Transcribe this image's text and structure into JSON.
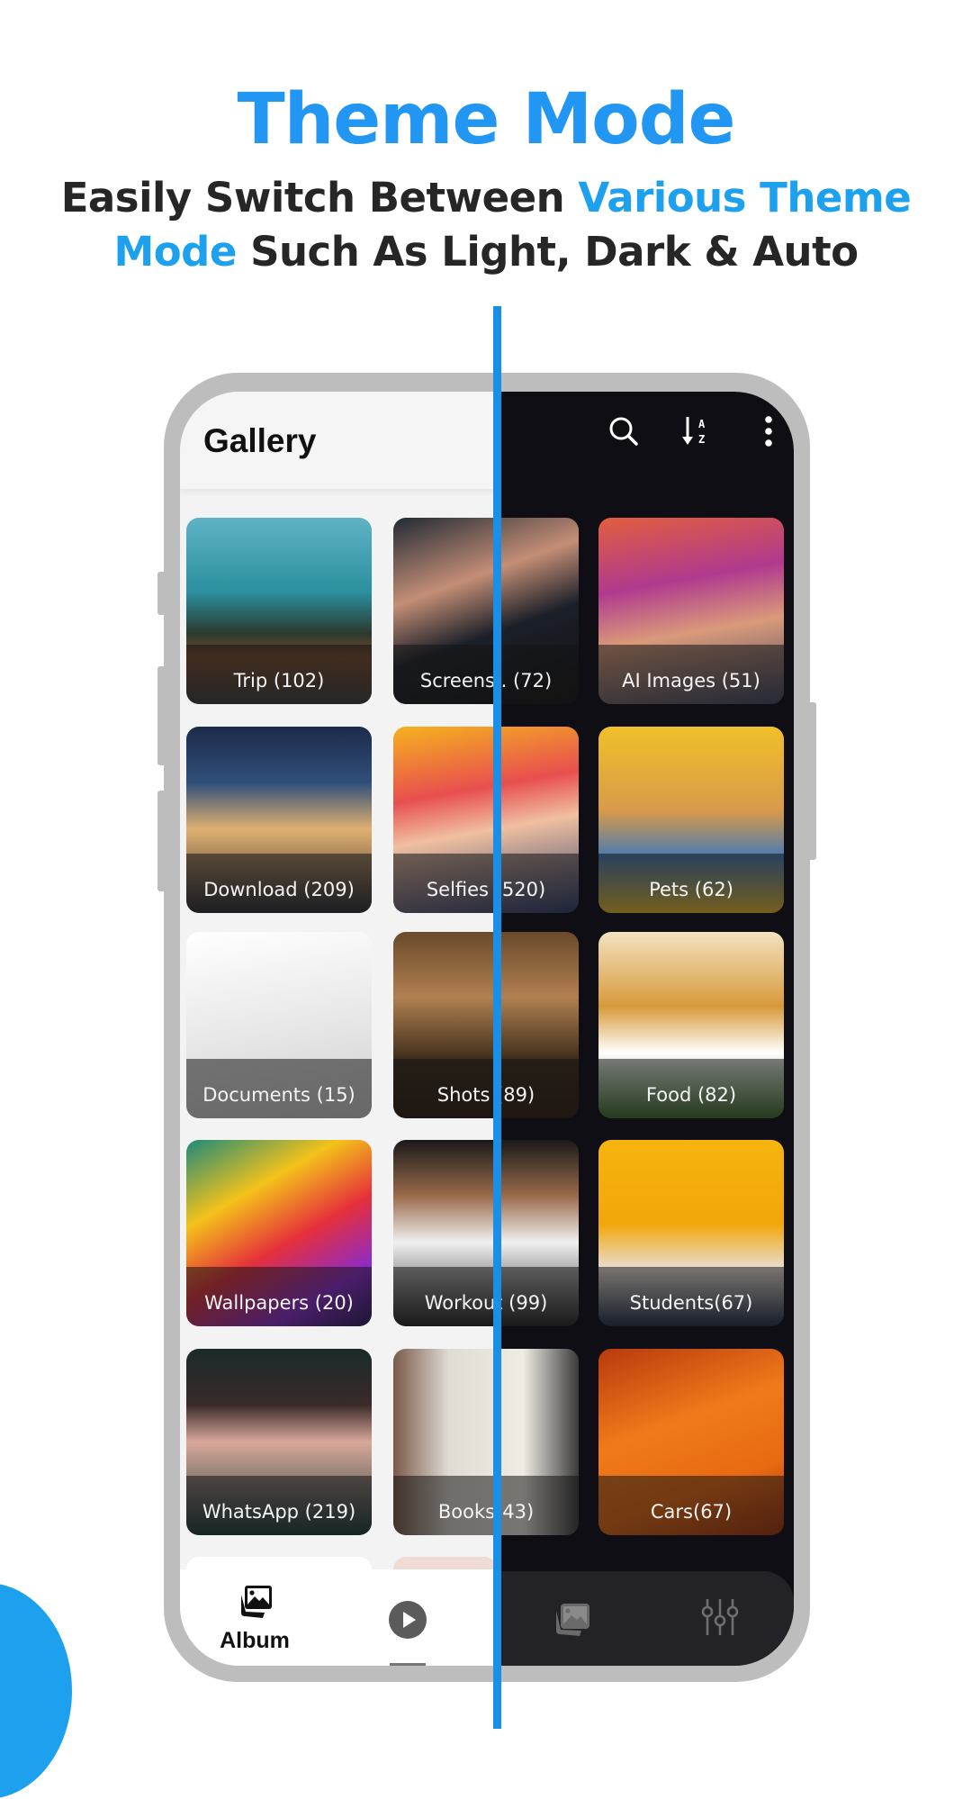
{
  "header": {
    "title": "Theme Mode",
    "subtitle_parts": [
      {
        "text": "Easily Switch Between ",
        "highlight": false
      },
      {
        "text": "Various Theme Mode",
        "highlight": true
      },
      {
        "text": " Such As Light, Dark & Auto",
        "highlight": false
      }
    ],
    "subtitle_line1_plain": "Easily Switch Between ",
    "subtitle_line1_hl": "Various Theme",
    "subtitle_line2_hl": "Mode",
    "subtitle_line2_plain": " Such As Light, Dark & Auto"
  },
  "colors": {
    "title_blue": "#2196f3",
    "highlight_blue": "#1da1ef",
    "divider_blue": "#1a8fe8",
    "dark_bg": "#0e0e14",
    "light_bg": "#f3f3f3",
    "frame_gray": "#bdbdbd"
  },
  "app": {
    "title": "Gallery",
    "toolbar_icons": [
      "search-icon",
      "sort-az-icon",
      "more-vert-icon"
    ]
  },
  "albums": [
    {
      "label": "Trip (102)",
      "icon": "landscape-photo"
    },
    {
      "label": "Screens.. (72)",
      "icon": "watch-photo"
    },
    {
      "label": "AI Images (51)",
      "icon": "ai-portrait"
    },
    {
      "label": "Download (209)",
      "icon": "city-night-photo"
    },
    {
      "label": "Selfies (520)",
      "icon": "selfie-photo"
    },
    {
      "label": "Pets (62)",
      "icon": "dog-photo"
    },
    {
      "label": "Documents (15)",
      "icon": "documents-photo"
    },
    {
      "label": "Shots (89)",
      "icon": "couple-photo"
    },
    {
      "label": "Food (82)",
      "icon": "food-photo"
    },
    {
      "label": "Wallpapers (20)",
      "icon": "color-smoke-photo"
    },
    {
      "label": "Workout (99)",
      "icon": "gym-photo"
    },
    {
      "label": "Students(67)",
      "icon": "student-photo"
    },
    {
      "label": "WhatsApp (219)",
      "icon": "portrait-photo"
    },
    {
      "label": "Books(43)",
      "icon": "book-photo"
    },
    {
      "label": "Cars(67)",
      "icon": "car-photo"
    }
  ],
  "bottom_nav": {
    "items": [
      {
        "label": "Album",
        "icon": "album-icon",
        "active": true
      },
      {
        "label": "",
        "icon": "video-play-icon",
        "active": false
      },
      {
        "label": "",
        "icon": "photos-icon",
        "active": false
      },
      {
        "label": "",
        "icon": "settings-sliders-icon",
        "active": false
      }
    ]
  }
}
